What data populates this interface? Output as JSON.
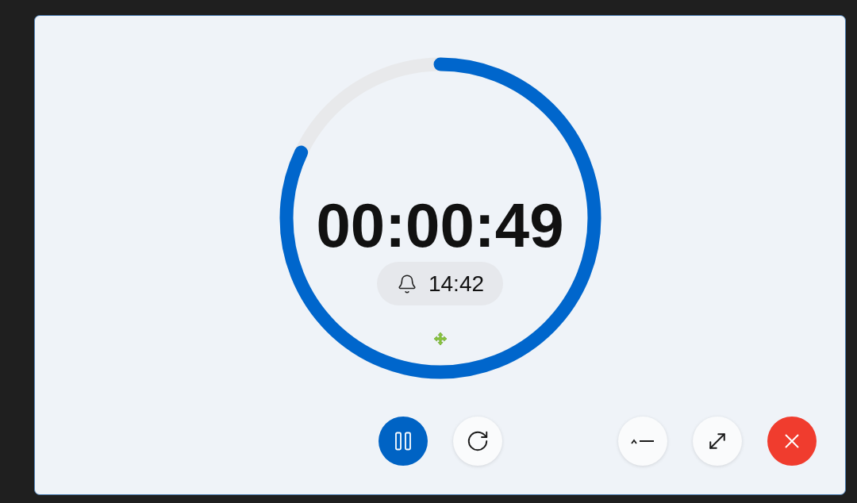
{
  "timer": {
    "remaining": "00:00:49",
    "level": 0.82,
    "alarm": {
      "time": "14:42"
    }
  },
  "playback_buttons": [
    {
      "kind": "pause"
    },
    {
      "kind": "reset"
    }
  ],
  "window_buttons": [
    {
      "kind": "collapse"
    },
    {
      "kind": "expand"
    },
    {
      "kind": "close"
    }
  ]
}
